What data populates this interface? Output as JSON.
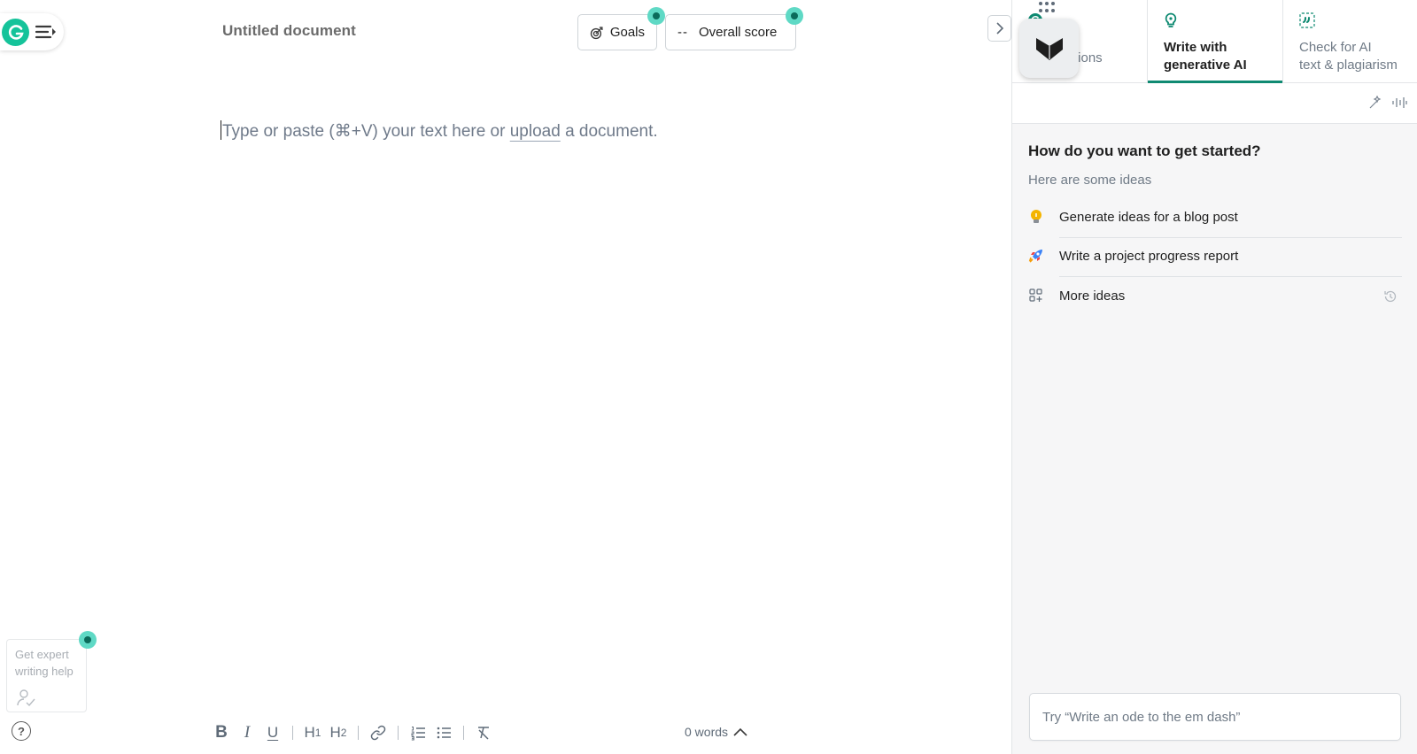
{
  "document": {
    "title": "Untitled document",
    "goals_label": "Goals",
    "score_value": "--",
    "score_label": "Overall score",
    "placeholder_before": "Type or paste (⌘+V) your text here or ",
    "upload_link": "upload",
    "placeholder_after": " a document."
  },
  "sidebar_help": {
    "expert_line1": "Get expert",
    "expert_line2": "writing help",
    "help_icon": "?"
  },
  "toolbar": {
    "bold": "B",
    "italic": "I",
    "underline": "U",
    "h1": "H",
    "h1_sub": "1",
    "h2": "H",
    "h2_sub": "2",
    "word_count": "0 words"
  },
  "panel": {
    "tabs": [
      {
        "id": "suggestions",
        "label_visible": "tions",
        "icon": "grammarly-icon"
      },
      {
        "id": "generative-ai",
        "line1": "Write with",
        "line2": "generative AI",
        "icon": "lightbulb-icon",
        "active": true
      },
      {
        "id": "check",
        "line1": "Check for AI",
        "line2": "text & plagiarism",
        "icon": "quote-icon"
      }
    ],
    "start_title": "How do you want to get started?",
    "start_subtitle": "Here are some ideas",
    "ideas": [
      {
        "label": "Generate ideas for a blog post",
        "icon": "lightbulb-icon"
      },
      {
        "label": "Write a project progress report",
        "icon": "rocket-icon"
      },
      {
        "label": "More ideas",
        "icon": "grid-plus-icon"
      }
    ],
    "prompt_placeholder": "Try “Write an ode to the em dash”"
  },
  "colors": {
    "brand_green": "#15c39a",
    "active_tab_underline": "#0f8a72",
    "dot_teal": "#5fd9c5"
  }
}
